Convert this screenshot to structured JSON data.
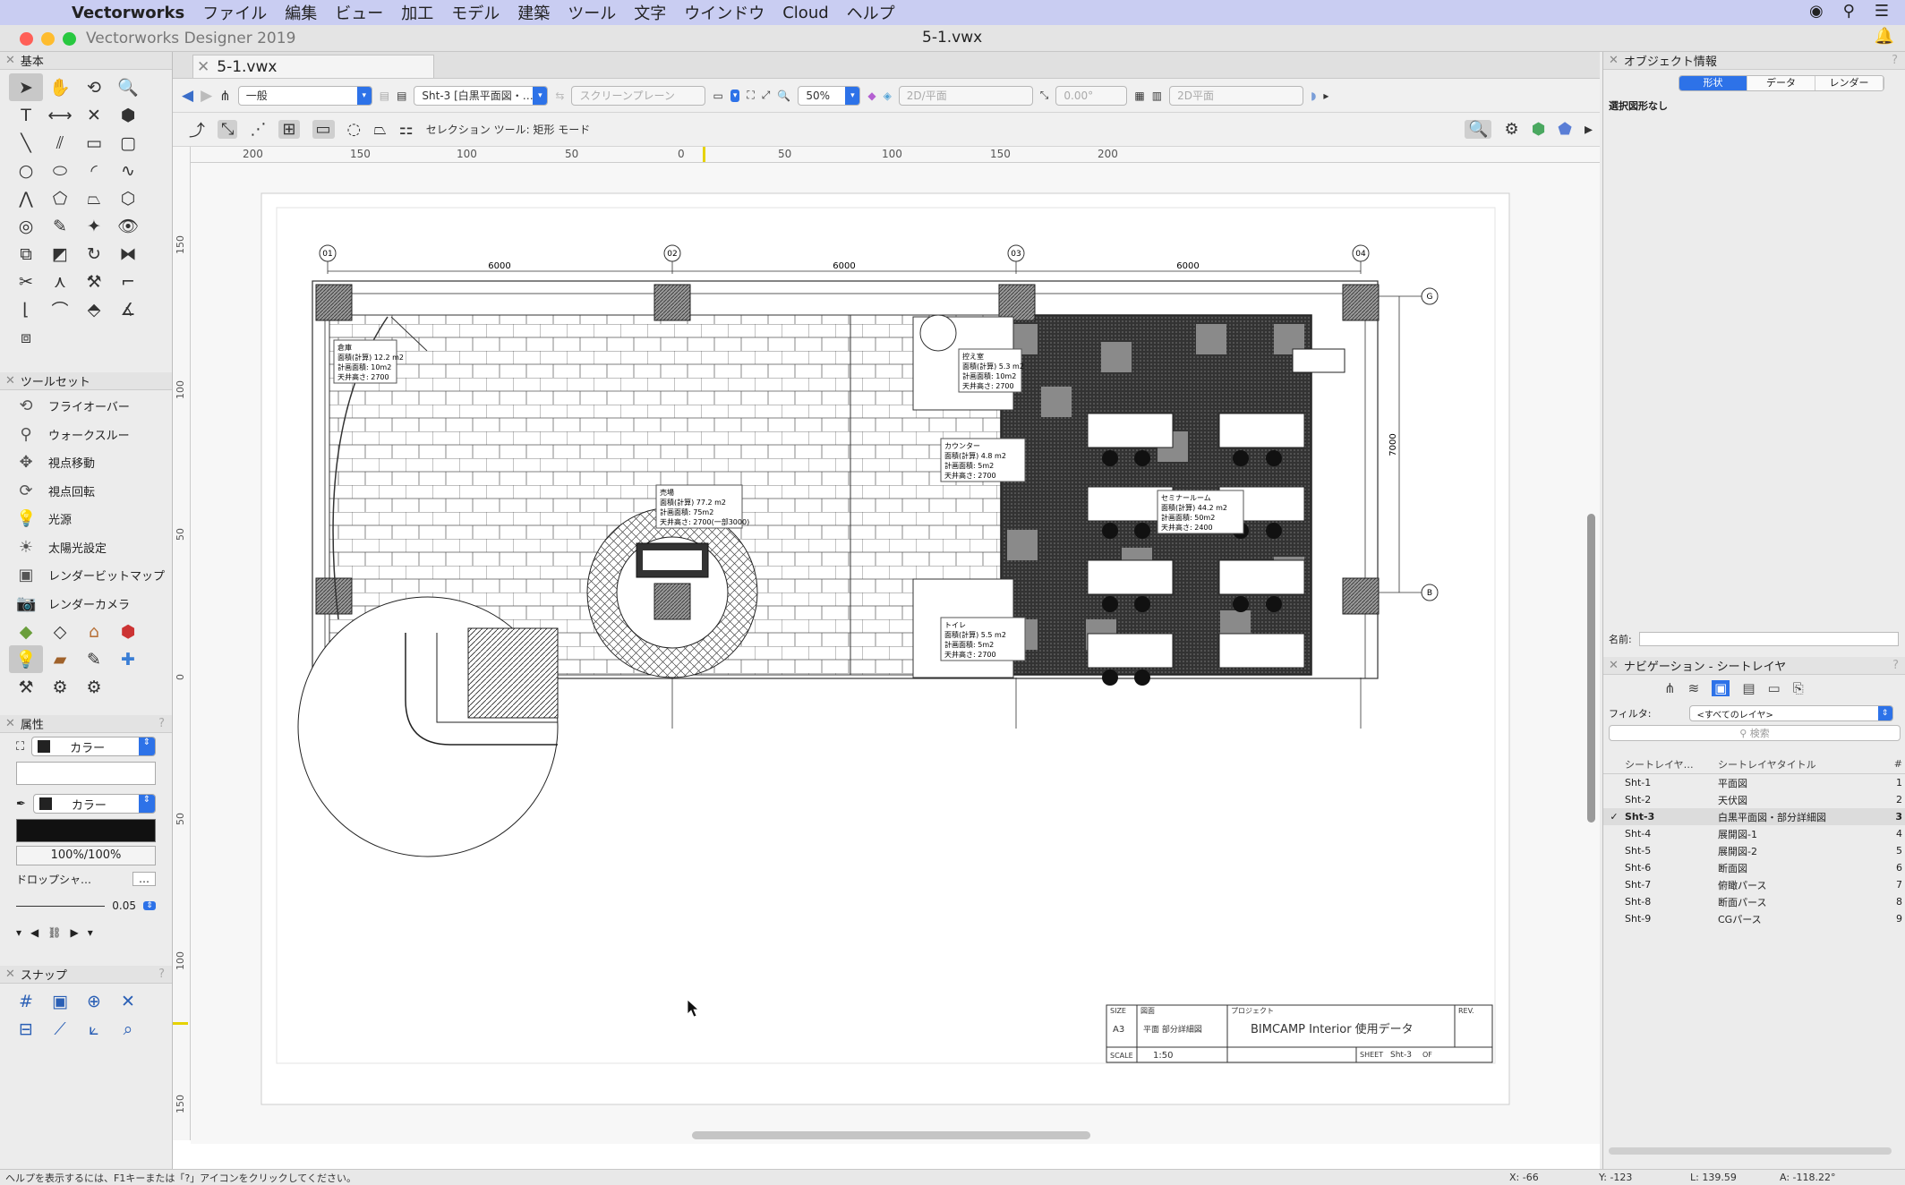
{
  "menubar": {
    "app": "Vectorworks",
    "items": [
      "ファイル",
      "編集",
      "ビュー",
      "加工",
      "モデル",
      "建築",
      "ツール",
      "文字",
      "ウインドウ",
      "Cloud",
      "ヘルプ"
    ]
  },
  "window": {
    "app_title": "Vectorworks Designer 2019",
    "doc_title": "5-1.vwx"
  },
  "tab": {
    "label": "5-1.vwx"
  },
  "panels": {
    "basic_title": "基本",
    "toolset_title": "ツールセット",
    "toolset_items": [
      "フライオーバー",
      "ウォークスルー",
      "視点移動",
      "視点回転",
      "光源",
      "太陽光設定",
      "レンダービットマップ",
      "レンダーカメラ"
    ],
    "attr_title": "属性",
    "fill_label": "カラー",
    "pen_label": "カラー",
    "opacity": "100%/100%",
    "dropshadow": "ドロップシャ…",
    "line_weight": "0.05",
    "snap_title": "スナップ"
  },
  "viewbar": {
    "class": "一般",
    "layer": "Sht-3 [白黒平面図・…",
    "plane": "スクリーンプレーン",
    "zoom": "50%",
    "view": "2D/平面",
    "angle": "0.00°",
    "render": "2D平面"
  },
  "modebar": {
    "label": "セレクション ツール: 矩形 モード"
  },
  "ruler": {
    "h": [
      "200",
      "150",
      "100",
      "50",
      "0",
      "50",
      "100",
      "150",
      "200"
    ],
    "v": [
      "150",
      "100",
      "50",
      "0",
      "50",
      "100",
      "150"
    ]
  },
  "drawing": {
    "grid_bubbles": [
      "01",
      "02",
      "03",
      "04"
    ],
    "row_bubbles": [
      "G",
      "B"
    ],
    "spans": [
      "6000",
      "6000",
      "6000"
    ],
    "depth": "7000",
    "rooms": [
      {
        "name": "倉庫",
        "area": "面積(計算) 12.2 m2",
        "plan": "計画面積: 10m2",
        "ceil": "天井高さ: 2700"
      },
      {
        "name": "控え室",
        "area": "面積(計算) 5.3 m2",
        "plan": "計画面積: 10m2",
        "ceil": "天井高さ: 2700"
      },
      {
        "name": "カウンター",
        "area": "面積(計算) 4.8 m2",
        "plan": "計画面積: 5m2",
        "ceil": "天井高さ: 2700"
      },
      {
        "name": "売場",
        "area": "面積(計算) 77.2 m2",
        "plan": "計画面積: 75m2",
        "ceil": "天井高さ: 2700(一部3000)"
      },
      {
        "name": "セミナールーム",
        "area": "面積(計算) 44.2 m2",
        "plan": "計画面積: 50m2",
        "ceil": "天井高さ: 2400"
      },
      {
        "name": "トイレ",
        "area": "面積(計算) 5.5 m2",
        "plan": "計画面積: 5m2",
        "ceil": "天井高さ: 2700"
      }
    ],
    "titleblock": {
      "size_label": "SIZE",
      "size": "A3",
      "drawing_label": "図面",
      "drawing": "平面 部分詳細図",
      "project_label": "プロジェクト",
      "project": "BIMCAMP Interior 使用データ",
      "rev_label": "REV.",
      "scale_label": "SCALE",
      "scale": "1:50",
      "sheet_label": "SHEET",
      "sheet": "Sht-3",
      "of": "OF"
    }
  },
  "obj_info": {
    "title": "オブジェクト情報",
    "tabs": [
      "形状",
      "データ",
      "レンダー"
    ],
    "status": "選択図形なし",
    "name_label": "名前:"
  },
  "navigation": {
    "title": "ナビゲーション - シートレイヤ",
    "filter_label": "フィルタ:",
    "filter_value": "<すべてのレイヤ>",
    "search_placeholder": "検索",
    "col1": "シートレイヤ…",
    "col2": "シートレイヤタイトル",
    "col3": "#",
    "rows": [
      {
        "id": "Sht-1",
        "title": "平面図",
        "num": "1",
        "active": ""
      },
      {
        "id": "Sht-2",
        "title": "天伏図",
        "num": "2",
        "active": ""
      },
      {
        "id": "Sht-3",
        "title": "白黒平面図・部分詳細図",
        "num": "3",
        "active": "✓"
      },
      {
        "id": "Sht-4",
        "title": "展開図-1",
        "num": "4",
        "active": ""
      },
      {
        "id": "Sht-5",
        "title": "展開図-2",
        "num": "5",
        "active": ""
      },
      {
        "id": "Sht-6",
        "title": "断面図",
        "num": "6",
        "active": ""
      },
      {
        "id": "Sht-7",
        "title": "俯瞰パース",
        "num": "7",
        "active": ""
      },
      {
        "id": "Sht-8",
        "title": "断面パース",
        "num": "8",
        "active": ""
      },
      {
        "id": "Sht-9",
        "title": "CGパース",
        "num": "9",
        "active": ""
      }
    ]
  },
  "status": {
    "help": "ヘルプを表示するには、F1キーまたは「?」アイコンをクリックしてください。",
    "x": "X: -66",
    "y": "Y: -123",
    "l": "L: 139.59",
    "a": "A: -118.22°"
  }
}
